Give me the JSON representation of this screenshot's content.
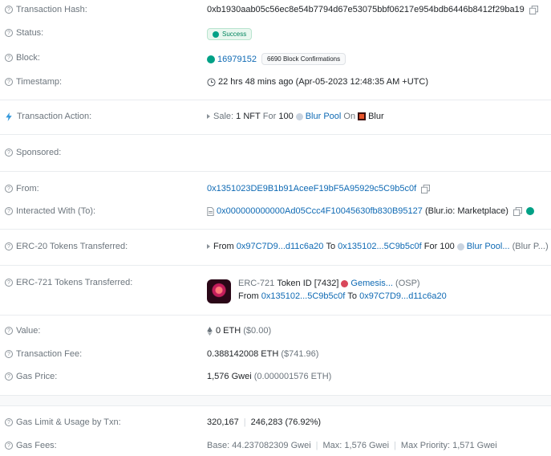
{
  "tx_hash": {
    "label": "Transaction Hash:",
    "value": "0xb1930aab05c56ec8e54b7794d67e53075bbf06217e954bdb6446b8412f29ba19"
  },
  "status": {
    "label": "Status:",
    "value": "Success"
  },
  "block": {
    "label": "Block:",
    "number": "16979152",
    "confirmations": "6690 Block Confirmations"
  },
  "timestamp": {
    "label": "Timestamp:",
    "value": "22 hrs 48 mins ago (Apr-05-2023 12:48:35 AM +UTC)"
  },
  "action": {
    "label": "Transaction Action:",
    "prefix": "Sale:",
    "count": "1",
    "nft": "NFT",
    "for": "For",
    "amount": "100",
    "pool": "Blur Pool",
    "on": "On",
    "market": "Blur"
  },
  "sponsored": {
    "label": "Sponsored:"
  },
  "from": {
    "label": "From:",
    "value": "0x1351023DE9B1b91AceeF19bF5A95929c5C9b5c0f"
  },
  "interacted": {
    "label": "Interacted With (To):",
    "address": "0x000000000000Ad05Ccc4F10045630fb830B95127",
    "name": "(Blur.io: Marketplace)"
  },
  "erc20": {
    "label": "ERC-20 Tokens Transferred:",
    "from_word": "From",
    "from": "0x97C7D9...d11c6a20",
    "to_word": "To",
    "to": "0x135102...5C9b5c0f",
    "for_word": "For",
    "amount": "100",
    "token": "Blur Pool...",
    "token_symbol": "(Blur P...)"
  },
  "erc721": {
    "label": "ERC-721 Tokens Transferred:",
    "standard": "ERC-721",
    "token_id_word": "Token ID",
    "token_id": "[7432]",
    "collection": "Gemesis...",
    "symbol": "(OSP)",
    "from_word": "From",
    "from": "0x135102...5C9b5c0f",
    "to_word": "To",
    "to": "0x97C7D9...d11c6a20"
  },
  "value": {
    "label": "Value:",
    "eth": "0 ETH",
    "usd": "($0.00)"
  },
  "fee": {
    "label": "Transaction Fee:",
    "eth": "0.388142008 ETH",
    "usd": "($741.96)"
  },
  "gas_price": {
    "label": "Gas Price:",
    "value": "1,576 Gwei",
    "eth": "(0.000001576 ETH)"
  },
  "gas_limit": {
    "label": "Gas Limit & Usage by Txn:",
    "limit": "320,167",
    "usage": "246,283 (76.92%)"
  },
  "gas_fees": {
    "label": "Gas Fees:",
    "base": "Base: 44.237082309 Gwei",
    "max": "Max: 1,576 Gwei",
    "priority": "Max Priority: 1,571 Gwei"
  },
  "icons": [
    "question-circle-icon",
    "copy-icon",
    "check-circle-icon",
    "clock-icon",
    "lightning-icon",
    "play-triangle-icon",
    "eth-icon",
    "document-icon",
    "verified-icon"
  ],
  "colors": {
    "link": "#0f6ab4",
    "success": "#00a186",
    "label": "#6c757d"
  }
}
